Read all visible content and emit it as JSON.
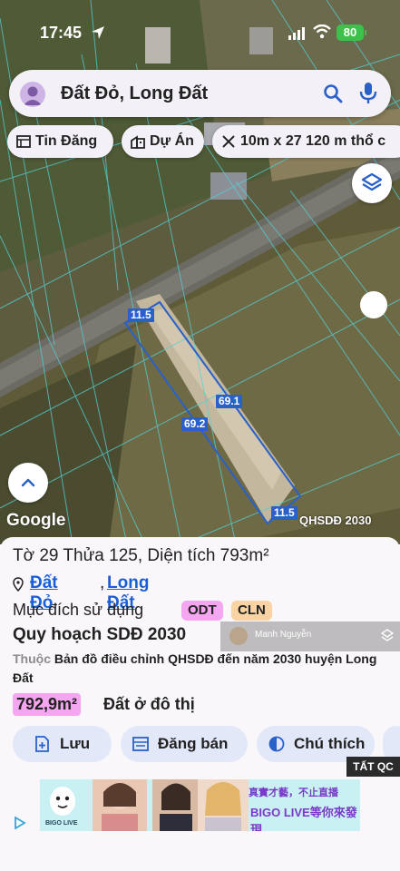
{
  "status": {
    "time": "17:45",
    "battery": "80"
  },
  "search": {
    "query": "Đất Đỏ, Long Đất"
  },
  "chips": [
    {
      "label": "Tin Đăng",
      "icon": "list-icon"
    },
    {
      "label": "Dự Án",
      "icon": "building-icon"
    },
    {
      "label": "10m x 27 120 m thổ c",
      "icon": "ruler-icon"
    }
  ],
  "map": {
    "dimensions": {
      "top": "11.5",
      "right_side": "69.1",
      "left_side": "69.2",
      "bottom": "11.5"
    },
    "attribution": "Google",
    "layer_label": "QHSDĐ 2030"
  },
  "parcel": {
    "title": "Tờ 29 Thửa 125, Diện tích 793m²",
    "district": "Đất Đỏ",
    "separator": ",",
    "ward": "Long Đất",
    "purpose_label": "Mục đích sử dụng",
    "purpose_codes": [
      "ODT",
      "CLN"
    ],
    "plan_heading": "Quy hoạch SDĐ 2030",
    "plan_prefix": "Thuộc",
    "plan_description": "Bản đồ điều chỉnh QHSDĐ đến năm 2030 huyện Long Đất",
    "area_value": "792,9m²",
    "area_label": "Đất ở đô thị"
  },
  "overlay": {
    "user_name": "Manh Nguyễn"
  },
  "actions": [
    {
      "label": "Lưu",
      "icon": "save-icon"
    },
    {
      "label": "Đăng bán",
      "icon": "listing-icon"
    },
    {
      "label": "Chú thích",
      "icon": "legend-icon"
    }
  ],
  "ad": {
    "close_label": "TẤT QC",
    "brand_small": "BIGO LIVE",
    "slogan": "真實才藝，不止直播",
    "brand": "BIGO LIVE等你來發現"
  },
  "colors": {
    "accent": "#2a61c9",
    "odt": "#f5a6f1",
    "cln": "#f9d3a3",
    "battery": "#3cc24a"
  }
}
